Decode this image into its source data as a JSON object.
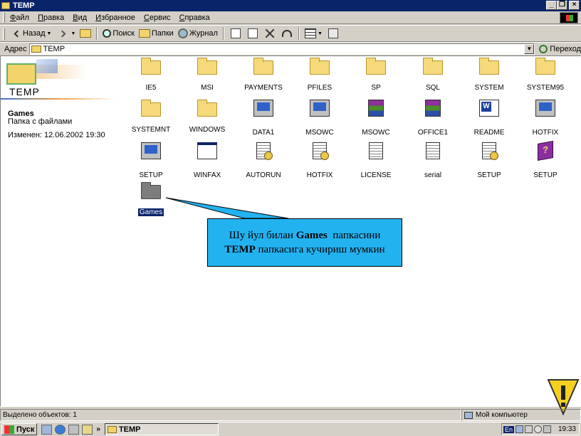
{
  "window": {
    "title": "TEMP"
  },
  "menu": [
    "Файл",
    "Правка",
    "Вид",
    "Избранное",
    "Сервис",
    "Справка"
  ],
  "toolbar": {
    "back": "Назад",
    "search": "Поиск",
    "folders": "Папки",
    "history": "Журнал"
  },
  "address": {
    "label": "Адрес",
    "value": "TEMP",
    "go": "Переход"
  },
  "left_panel": {
    "title": "TEMP",
    "name": "Games",
    "type": "Папка с файлами",
    "modified": "Изменен: 12.06.2002 19:30"
  },
  "icons": [
    {
      "label": "IE5",
      "kind": "folder"
    },
    {
      "label": "MSI",
      "kind": "folder"
    },
    {
      "label": "PAYMENTS",
      "kind": "folder"
    },
    {
      "label": "PFILES",
      "kind": "folder"
    },
    {
      "label": "SP",
      "kind": "folder"
    },
    {
      "label": "SQL",
      "kind": "folder"
    },
    {
      "label": "SYSTEM",
      "kind": "folder"
    },
    {
      "label": "SYSTEM95",
      "kind": "folder"
    },
    {
      "label": "SYSTEMNT",
      "kind": "folder"
    },
    {
      "label": "WINDOWS",
      "kind": "folder"
    },
    {
      "label": "DATA1",
      "kind": "setup"
    },
    {
      "label": "MSOWC",
      "kind": "setup"
    },
    {
      "label": "MSOWC",
      "kind": "rar"
    },
    {
      "label": "OFFICE1",
      "kind": "rar"
    },
    {
      "label": "README",
      "kind": "word"
    },
    {
      "label": "HOTFIX",
      "kind": "setup"
    },
    {
      "label": "SETUP",
      "kind": "setup"
    },
    {
      "label": "WINFAX",
      "kind": "window"
    },
    {
      "label": "AUTORUN",
      "kind": "config"
    },
    {
      "label": "HOTFIX",
      "kind": "config"
    },
    {
      "label": "LICENSE",
      "kind": "text"
    },
    {
      "label": "serial",
      "kind": "text"
    },
    {
      "label": "SETUP",
      "kind": "config"
    },
    {
      "label": "SETUP",
      "kind": "help"
    },
    {
      "label": "Games",
      "kind": "gamesfolder",
      "selected": true
    }
  ],
  "callout": {
    "line1_pre": "Шу йул билан ",
    "line1_bold": "Games",
    "line1_post": "  папкасини",
    "line2_bold": "TEMP",
    "line2_post": " папкасига кучириш мумкин"
  },
  "status": {
    "selected": "Выделено объектов: 1",
    "location": "Мой компьютер"
  },
  "taskbar": {
    "start": "Пуск",
    "window": "TEMP",
    "lang": "En",
    "clock": "19:33"
  },
  "colors": {
    "titlebar": "#0a246a",
    "callout": "#23b2f0",
    "selection": "#0a246a",
    "warning": "#f5d020"
  }
}
